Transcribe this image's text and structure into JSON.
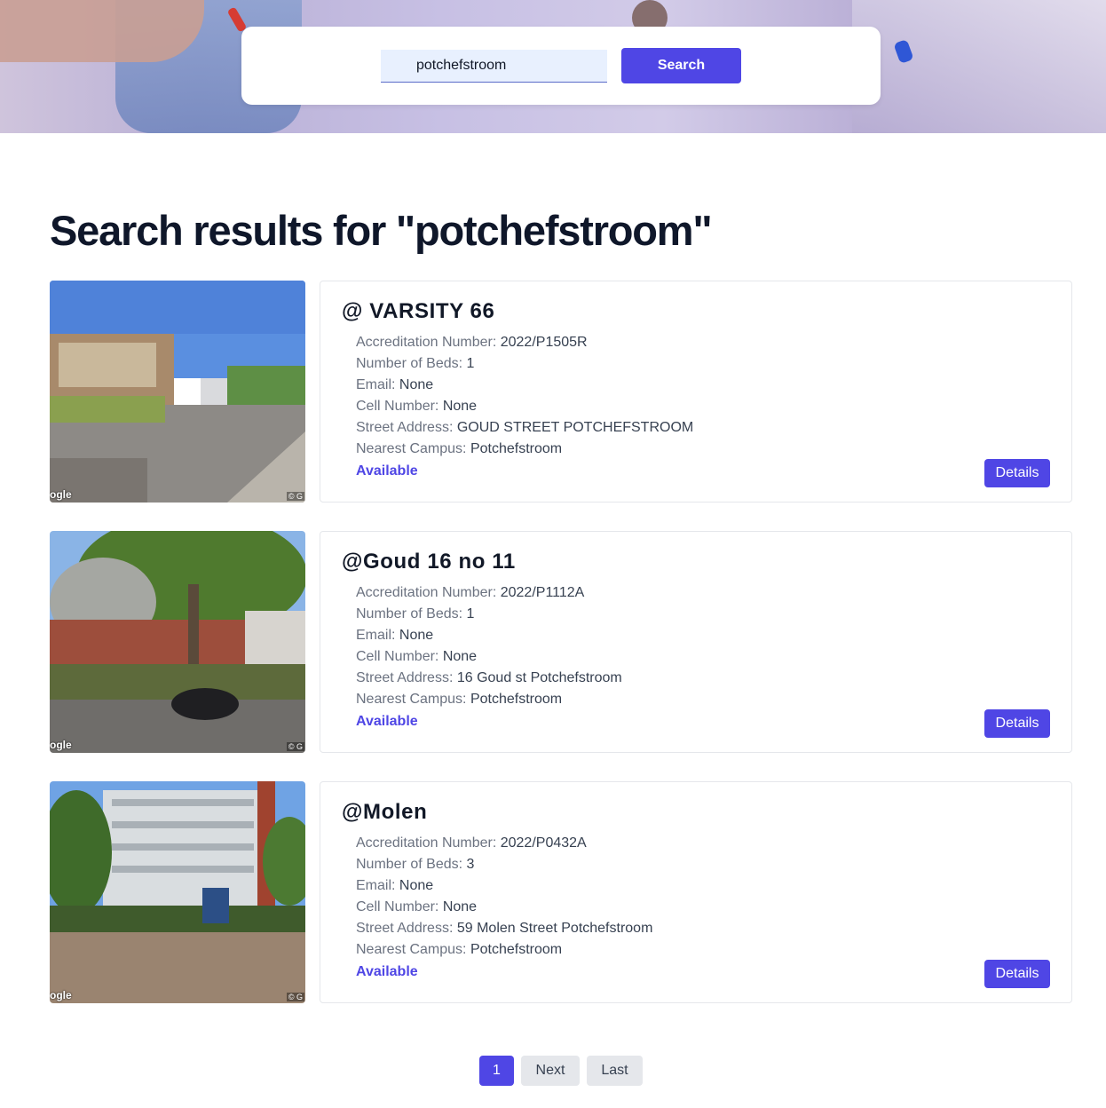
{
  "search": {
    "value": "potchefstroom",
    "button_label": "Search"
  },
  "results_heading": "Search results for \"potchefstroom\"",
  "labels": {
    "accreditation": "Accreditation Number: ",
    "beds": "Number of Beds: ",
    "email": "Email: ",
    "cell": "Cell Number: ",
    "address": "Street Address: ",
    "campus": "Nearest Campus: ",
    "details": "Details"
  },
  "thumbnail": {
    "watermark": "ogle",
    "copyright": "© G"
  },
  "results": [
    {
      "name": "@ VARSITY 66",
      "accreditation": "2022/P1505R",
      "beds": "1",
      "email": "None",
      "cell": "None",
      "address": "GOUD STREET POTCHEFSTROOM",
      "campus": "Potchefstroom",
      "status": "Available"
    },
    {
      "name": "@Goud 16 no 11",
      "accreditation": "2022/P1112A",
      "beds": "1",
      "email": "None",
      "cell": "None",
      "address": "16 Goud st Potchefstroom",
      "campus": "Potchefstroom",
      "status": "Available"
    },
    {
      "name": "@Molen",
      "accreditation": "2022/P0432A",
      "beds": "3",
      "email": "None",
      "cell": "None",
      "address": "59 Molen Street Potchefstroom",
      "campus": "Potchefstroom",
      "status": "Available"
    }
  ],
  "pagination": {
    "current": "1",
    "next": "Next",
    "last": "Last"
  },
  "colors": {
    "accent": "#4f46e5",
    "title": "#0f172a",
    "label": "#6b7280"
  }
}
